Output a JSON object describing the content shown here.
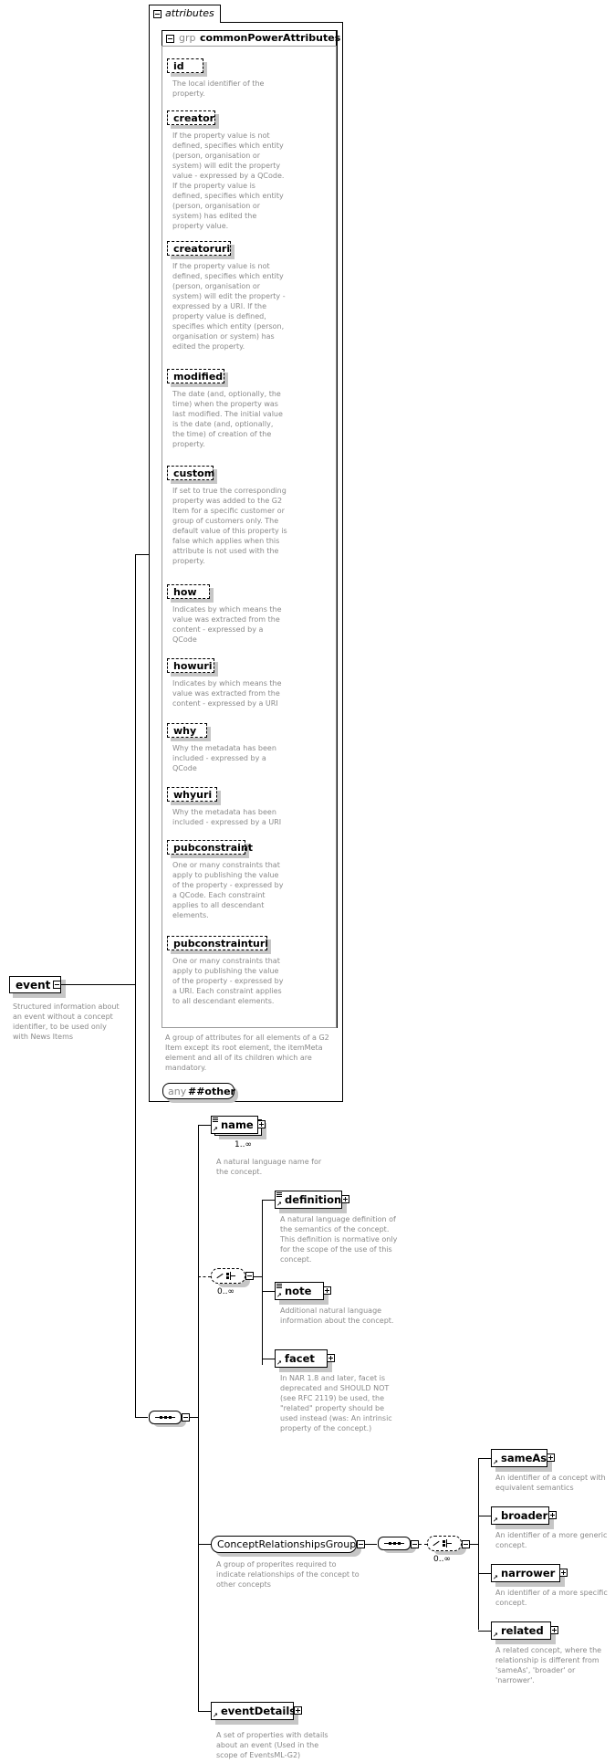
{
  "root": {
    "name": "event",
    "description": "Structured information about an event without a concept identifier, to be used only with News Items"
  },
  "attributes_panel": {
    "title": "attributes",
    "group": {
      "prefix": "grp",
      "name": "commonPowerAttributes",
      "description": "A group of attributes for all elements of a G2 Item except its root element, the itemMeta element and all of its children which are mandatory.",
      "attributes": [
        {
          "name": "id",
          "description": "The local identifier of the property."
        },
        {
          "name": "creator",
          "description": "If the property value is not defined, specifies which entity (person, organisation or system) will edit the property value - expressed by a QCode. If the property value is defined, specifies which entity (person, organisation or system) has edited the property value."
        },
        {
          "name": "creatoruri",
          "description": "If the property value is not defined, specifies which entity (person, organisation or system) will edit the property - expressed by a URI. If the property value is defined, specifies which entity (person, organisation or system) has edited the property."
        },
        {
          "name": "modified",
          "description": "The date (and, optionally, the time) when the property was last modified. The initial value is the date (and, optionally, the time) of creation of the property."
        },
        {
          "name": "custom",
          "description": "If set to true the corresponding property was added to the G2 Item for a specific customer or group of customers only. The default value of this property is false which applies when this attribute is not used with the property."
        },
        {
          "name": "how",
          "description": "Indicates by which means the value was extracted from the content - expressed by a QCode"
        },
        {
          "name": "howuri",
          "description": "Indicates by which means the value was extracted from the content - expressed by a URI"
        },
        {
          "name": "why",
          "description": "Why the metadata has been included - expressed by a QCode"
        },
        {
          "name": "whyuri",
          "description": "Why the metadata has been included - expressed by a URI"
        },
        {
          "name": "pubconstraint",
          "description": "One or many constraints that apply to publishing the value of the property - expressed by a QCode. Each constraint applies to all descendant elements."
        },
        {
          "name": "pubconstrainturi",
          "description": "One or many constraints that apply to publishing the value of the property - expressed by a URI. Each constraint applies to all descendant elements."
        }
      ]
    },
    "any": {
      "prefix": "any",
      "name": "##other"
    }
  },
  "sequence": {
    "name": {
      "label": "name",
      "occurrence": "1..∞",
      "description": "A natural language name for the concept."
    },
    "choice_occurrence": "0..∞",
    "choice_items": [
      {
        "label": "definition",
        "description": "A natural language definition of the semantics of the concept. This definition is normative only for the scope of the use of this concept."
      },
      {
        "label": "note",
        "description": "Additional natural language information about the concept."
      },
      {
        "label": "facet",
        "description": "In NAR 1.8 and later, facet is deprecated and SHOULD NOT (see RFC 2119) be used, the \"related\" property should be used instead (was: An intrinsic property of the concept.)"
      }
    ],
    "group": {
      "label": "ConceptRelationshipsGroup",
      "description": "A group of properites required to indicate relationships of the concept to other concepts",
      "choice_occurrence": "0..∞",
      "items": [
        {
          "label": "sameAs",
          "description": "An identifier of a concept with equivalent semantics"
        },
        {
          "label": "broader",
          "description": "An identifier of a more generic concept."
        },
        {
          "label": "narrower",
          "description": "An identifier of a more specific concept."
        },
        {
          "label": "related",
          "description": "A related concept, where the relationship is different from 'sameAs', 'broader' or 'narrower'."
        }
      ]
    },
    "eventDetails": {
      "label": "eventDetails",
      "description": "A set of properties with details about an event (Used in the scope of EventsML-G2)"
    }
  }
}
